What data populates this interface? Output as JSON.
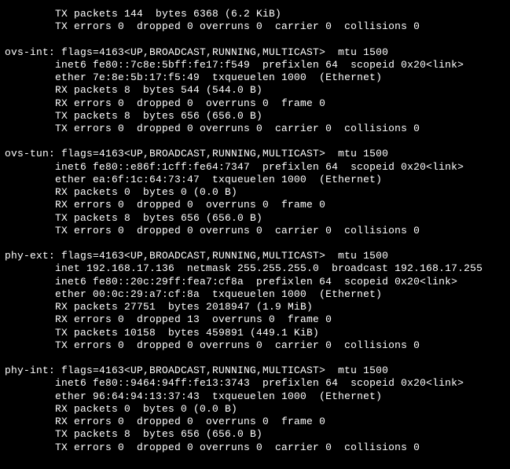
{
  "leading": {
    "tx_packets": "TX packets 144  bytes 6368 (6.2 KiB)",
    "tx_errors": "TX errors 0  dropped 0 overruns 0  carrier 0  collisions 0"
  },
  "interfaces": [
    {
      "name": "ovs-int",
      "header": "ovs-int: flags=4163<UP,BROADCAST,RUNNING,MULTICAST>  mtu 1500",
      "lines": [
        "inet6 fe80::7c8e:5bff:fe17:f549  prefixlen 64  scopeid 0x20<link>",
        "ether 7e:8e:5b:17:f5:49  txqueuelen 1000  (Ethernet)",
        "RX packets 8  bytes 544 (544.0 B)",
        "RX errors 0  dropped 0  overruns 0  frame 0",
        "TX packets 8  bytes 656 (656.0 B)",
        "TX errors 0  dropped 0 overruns 0  carrier 0  collisions 0"
      ]
    },
    {
      "name": "ovs-tun",
      "header": "ovs-tun: flags=4163<UP,BROADCAST,RUNNING,MULTICAST>  mtu 1500",
      "lines": [
        "inet6 fe80::e86f:1cff:fe64:7347  prefixlen 64  scopeid 0x20<link>",
        "ether ea:6f:1c:64:73:47  txqueuelen 1000  (Ethernet)",
        "RX packets 0  bytes 0 (0.0 B)",
        "RX errors 0  dropped 0  overruns 0  frame 0",
        "TX packets 8  bytes 656 (656.0 B)",
        "TX errors 0  dropped 0 overruns 0  carrier 0  collisions 0"
      ]
    },
    {
      "name": "phy-ext",
      "header": "phy-ext: flags=4163<UP,BROADCAST,RUNNING,MULTICAST>  mtu 1500",
      "lines": [
        "inet 192.168.17.136  netmask 255.255.255.0  broadcast 192.168.17.255",
        "inet6 fe80::20c:29ff:fea7:cf8a  prefixlen 64  scopeid 0x20<link>",
        "ether 00:0c:29:a7:cf:8a  txqueuelen 1000  (Ethernet)",
        "RX packets 27751  bytes 2018947 (1.9 MiB)",
        "RX errors 0  dropped 13  overruns 0  frame 0",
        "TX packets 10158  bytes 459891 (449.1 KiB)",
        "TX errors 0  dropped 0 overruns 0  carrier 0  collisions 0"
      ]
    },
    {
      "name": "phy-int",
      "header": "phy-int: flags=4163<UP,BROADCAST,RUNNING,MULTICAST>  mtu 1500",
      "lines": [
        "inet6 fe80::9464:94ff:fe13:3743  prefixlen 64  scopeid 0x20<link>",
        "ether 96:64:94:13:37:43  txqueuelen 1000  (Ethernet)",
        "RX packets 0  bytes 0 (0.0 B)",
        "RX errors 0  dropped 0  overruns 0  frame 0",
        "TX packets 8  bytes 656 (656.0 B)",
        "TX errors 0  dropped 0 overruns 0  carrier 0  collisions 0"
      ]
    }
  ],
  "indent": "        "
}
